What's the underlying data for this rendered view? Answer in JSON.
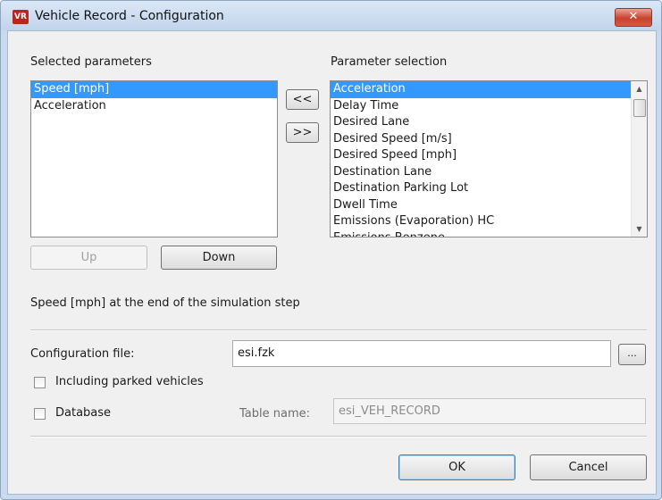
{
  "window": {
    "title": "Vehicle Record - Configuration",
    "close_glyph": "✕",
    "app_icon_text": "VR"
  },
  "selected": {
    "label": "Selected parameters",
    "items": [
      "Speed [mph]",
      "Acceleration"
    ]
  },
  "parameters": {
    "label": "Parameter selection",
    "items": [
      "Acceleration",
      "Delay Time",
      "Desired Lane",
      "Desired Speed [m/s]",
      "Desired Speed [mph]",
      "Destination Lane",
      "Destination Parking Lot",
      "Dwell Time",
      "Emissions (Evaporation) HC",
      "Emissions Benzene"
    ]
  },
  "buttons": {
    "add": "<<",
    "remove": ">>",
    "up": "Up",
    "down": "Down",
    "browse": "...",
    "ok": "OK",
    "cancel": "Cancel"
  },
  "description": "Speed [mph] at the end of the simulation step",
  "config_file": {
    "label": "Configuration file:",
    "value": "esi.fzk"
  },
  "parked": {
    "label": "Including parked vehicles",
    "checked": false
  },
  "database": {
    "label": "Database",
    "checked": false
  },
  "table_name": {
    "label": "Table name:",
    "value": "esi_VEH_RECORD"
  }
}
